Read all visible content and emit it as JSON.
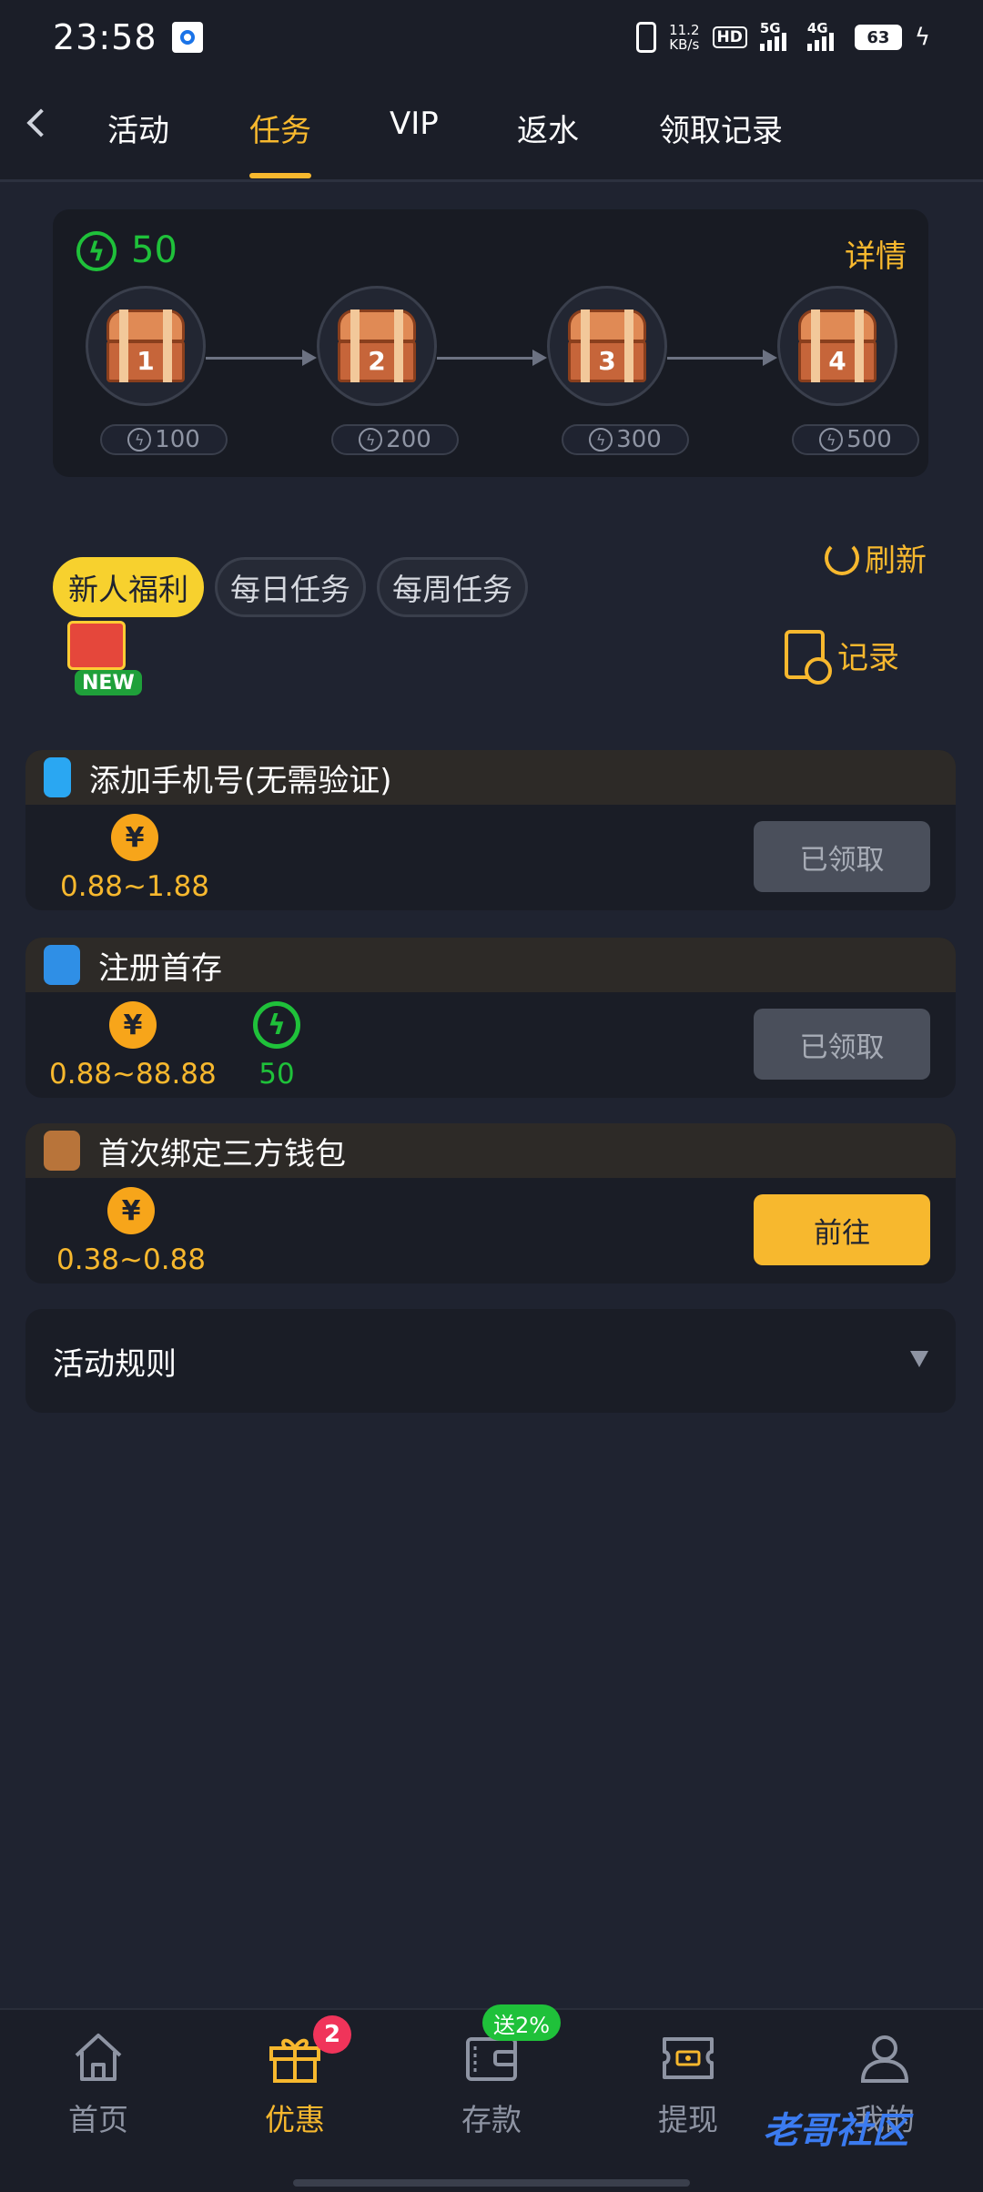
{
  "status_bar": {
    "time": "23:58",
    "net_speed_value": "11.2",
    "net_speed_unit": "KB/s",
    "hd_label": "HD",
    "sim1_label": "5G",
    "sim2_label": "4G",
    "battery": "63"
  },
  "header": {
    "tabs": [
      {
        "label": "活动"
      },
      {
        "label": "任务"
      },
      {
        "label": "VIP"
      },
      {
        "label": "返水"
      },
      {
        "label": "领取记录"
      }
    ],
    "active_tab": "任务"
  },
  "progress": {
    "energy": "50",
    "detail_label": "详情",
    "chests": [
      {
        "number": "1",
        "requirement": "100"
      },
      {
        "number": "2",
        "requirement": "200"
      },
      {
        "number": "3",
        "requirement": "300"
      },
      {
        "number": "4",
        "requirement": "500"
      }
    ]
  },
  "categories": {
    "tabs": [
      {
        "label": "新人福利"
      },
      {
        "label": "每日任务"
      },
      {
        "label": "每周任务"
      }
    ],
    "active": "新人福利",
    "new_badge": "NEW",
    "refresh_label": "刷新",
    "record_label": "记录"
  },
  "tasks": [
    {
      "title": "添加手机号(无需验证)",
      "coin_symbol": "¥",
      "reward": "0.88~1.88",
      "button": "已领取",
      "status": "claimed"
    },
    {
      "title": "注册首存",
      "coin_symbol": "¥",
      "reward": "0.88~88.88",
      "energy_reward": "50",
      "button": "已领取",
      "status": "claimed"
    },
    {
      "title": "首次绑定三方钱包",
      "coin_symbol": "¥",
      "reward": "0.38~0.88",
      "button": "前往",
      "status": "available"
    }
  ],
  "rules": {
    "title": "活动规则"
  },
  "bottom_nav": {
    "items": [
      {
        "label": "首页",
        "icon": "home-icon"
      },
      {
        "label": "优惠",
        "icon": "gift-icon",
        "badge": "2"
      },
      {
        "label": "存款",
        "icon": "wallet-icon",
        "badge": "送2%"
      },
      {
        "label": "提现",
        "icon": "ticket-icon"
      },
      {
        "label": "我的",
        "icon": "user-icon"
      }
    ],
    "active": "优惠"
  },
  "watermark": "老哥社区",
  "colors": {
    "background": "#1f2330",
    "accent": "#f7b82e",
    "energy_green": "#1fc13a",
    "badge_red": "#f0345a"
  }
}
